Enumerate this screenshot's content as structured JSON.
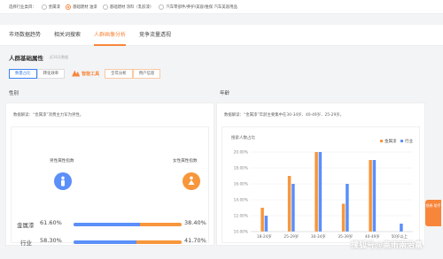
{
  "filter_bar": {
    "label": "选择行业类目：",
    "options": [
      {
        "label": "金属漆",
        "selected": false
      },
      {
        "label": "基础建材 油漆",
        "selected": true
      },
      {
        "label": "基础建材 涂料（乳胶漆）",
        "selected": false
      },
      {
        "label": "汽车零部件/养护/美容/维保 汽车美容用品",
        "selected": false
      }
    ]
  },
  "tabs": [
    {
      "label": "市场数据趋势",
      "active": false
    },
    {
      "label": "相关词搜索",
      "active": false
    },
    {
      "label": "人群画像分析",
      "active": true
    },
    {
      "label": "竞争流量透视",
      "active": false
    }
  ],
  "section": {
    "title": "人群基础属性",
    "subtitle": "近30天数据"
  },
  "buttons": {
    "b1": "数量占比",
    "b2": "转化效率",
    "brand": "智能工具",
    "b3": "全年分析",
    "b4": "用户信息"
  },
  "gender": {
    "label": "性别",
    "hint": "数据解读：“金属漆”消费主力军为男性。",
    "male_title": "男性属性指数",
    "female_title": "女性属性指数",
    "rows": [
      {
        "name": "金属漆",
        "male": "61.60%",
        "female": "38.40%",
        "male_share": 0.616
      },
      {
        "name": "行业",
        "male": "58.30%",
        "female": "41.70%",
        "male_share": 0.583
      }
    ]
  },
  "age": {
    "label": "年龄",
    "hint": "数据解读：“金属漆”年龄主要集中在30-34岁、40-49岁、25-29岁。",
    "colors": {
      "series1": "#f7963b",
      "series2": "#5b8ff9"
    }
  },
  "chart_data": {
    "type": "bar",
    "title": "",
    "ylabel": "搜索人数占比",
    "categories": [
      "18-24岁",
      "25-29岁",
      "30-34岁",
      "35-39岁",
      "40-49岁",
      "50岁以上"
    ],
    "series": [
      {
        "name": "金属漆",
        "values": [
          13.0,
          17.0,
          20.0,
          13.5,
          19.0,
          10.0
        ]
      },
      {
        "name": "行业",
        "values": [
          12.0,
          16.0,
          20.0,
          16.0,
          19.0,
          11.0
        ]
      }
    ],
    "yticks": [
      "20.00%",
      "18.00%",
      "16.00%",
      "14.00%",
      "12.00%",
      "10.00%"
    ],
    "ylim": [
      10,
      20
    ],
    "grid": true,
    "legend": "top-right"
  },
  "watermark": "搜狐号@高雨南治富",
  "side_widget": "领券 助手"
}
